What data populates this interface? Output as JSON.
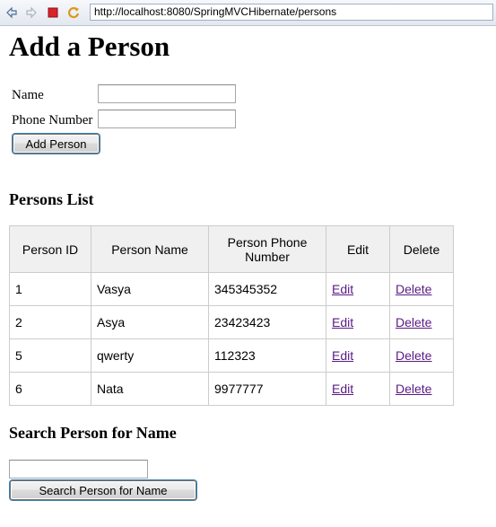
{
  "browser": {
    "url": "http://localhost:8080/SpringMVCHibernate/persons",
    "buttons": [
      "back-icon",
      "forward-icon",
      "stop-icon",
      "refresh-icon"
    ]
  },
  "form": {
    "title": "Add a Person",
    "name_label": "Name",
    "name_value": "",
    "phone_label": "Phone Number",
    "phone_value": "",
    "submit_label": "Add Person"
  },
  "persons": {
    "heading": "Persons List",
    "columns": [
      "Person ID",
      "Person Name",
      "Person Phone Number",
      "Edit",
      "Delete"
    ],
    "rows": [
      {
        "id": "1",
        "name": "Vasya",
        "phone": "345345352",
        "edit": "Edit",
        "delete": "Delete"
      },
      {
        "id": "2",
        "name": "Asya",
        "phone": "23423423",
        "edit": "Edit",
        "delete": "Delete"
      },
      {
        "id": "5",
        "name": "qwerty",
        "phone": "112323",
        "edit": "Edit",
        "delete": "Delete"
      },
      {
        "id": "6",
        "name": "Nata",
        "phone": "9977777",
        "edit": "Edit",
        "delete": "Delete"
      }
    ]
  },
  "search": {
    "heading": "Search Person for Name",
    "input_value": "",
    "button_label": "Search Person for Name"
  },
  "colors": {
    "link": "#5a1a84",
    "header_bg": "#f0f0f0",
    "border": "#cccccc"
  }
}
